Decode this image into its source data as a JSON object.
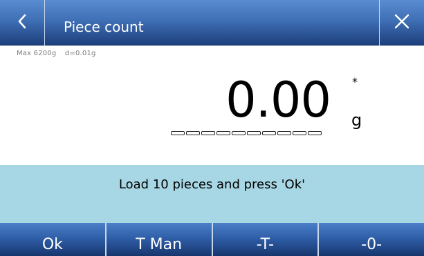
{
  "header": {
    "title": "Piece count",
    "back_icon": "chevron-left-icon",
    "close_icon": "close-icon"
  },
  "scale": {
    "max": "Max 6200g",
    "division": "d=0.01g",
    "weight": "0.00",
    "stability_mark": "*",
    "unit": "g",
    "bar_segments": 10
  },
  "message": {
    "text": "Load 10 pieces and press 'Ok'"
  },
  "footer": {
    "buttons": [
      "Ok",
      "T Man",
      "-T-",
      "-0-"
    ]
  },
  "colors": {
    "header_top": "#5a8cd2",
    "header_bottom": "#1c3e7a",
    "message_bg": "#a7d6e4"
  }
}
